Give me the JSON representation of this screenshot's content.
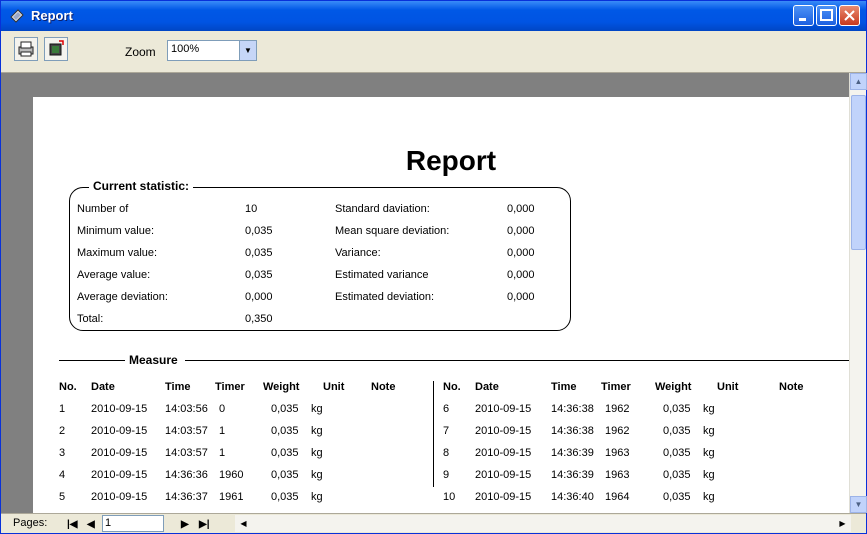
{
  "window": {
    "title": "Report"
  },
  "toolbar": {
    "zoom_label": "Zoom",
    "zoom_value": "100%"
  },
  "report": {
    "title": "Report",
    "statistic": {
      "heading": "Current statistic:",
      "left": [
        {
          "label": "Number of",
          "value": "10"
        },
        {
          "label": "Minimum value:",
          "value": "0,035"
        },
        {
          "label": "Maximum value:",
          "value": "0,035"
        },
        {
          "label": "Average value:",
          "value": "0,035"
        },
        {
          "label": "Average deviation:",
          "value": "0,000"
        },
        {
          "label": "Total:",
          "value": "0,350"
        }
      ],
      "right": [
        {
          "label": "Standard daviation:",
          "value": "0,000"
        },
        {
          "label": "Mean square deviation:",
          "value": "0,000"
        },
        {
          "label": "Variance:",
          "value": "0,000"
        },
        {
          "label": "Estimated  variance",
          "value": "0,000"
        },
        {
          "label": "Estimated deviation:",
          "value": "0,000"
        }
      ]
    },
    "measure": {
      "heading": "Measure",
      "columns": [
        "No.",
        "Date",
        "Time",
        "Timer",
        "Weight",
        "Unit",
        "Note"
      ],
      "rows_left": [
        [
          "1",
          "2010-09-15",
          "14:03:56",
          "0",
          "0,035",
          "kg",
          ""
        ],
        [
          "2",
          "2010-09-15",
          "14:03:57",
          "1",
          "0,035",
          "kg",
          ""
        ],
        [
          "3",
          "2010-09-15",
          "14:03:57",
          "1",
          "0,035",
          "kg",
          ""
        ],
        [
          "4",
          "2010-09-15",
          "14:36:36",
          "1960",
          "0,035",
          "kg",
          ""
        ],
        [
          "5",
          "2010-09-15",
          "14:36:37",
          "1961",
          "0,035",
          "kg",
          ""
        ]
      ],
      "rows_right": [
        [
          "6",
          "2010-09-15",
          "14:36:38",
          "1962",
          "0,035",
          "kg",
          ""
        ],
        [
          "7",
          "2010-09-15",
          "14:36:38",
          "1962",
          "0,035",
          "kg",
          ""
        ],
        [
          "8",
          "2010-09-15",
          "14:36:39",
          "1963",
          "0,035",
          "kg",
          ""
        ],
        [
          "9",
          "2010-09-15",
          "14:36:39",
          "1963",
          "0,035",
          "kg",
          ""
        ],
        [
          "10",
          "2010-09-15",
          "14:36:40",
          "1964",
          "0,035",
          "kg",
          ""
        ]
      ]
    }
  },
  "statusbar": {
    "pages_label": "Pages:",
    "page_value": "1"
  }
}
